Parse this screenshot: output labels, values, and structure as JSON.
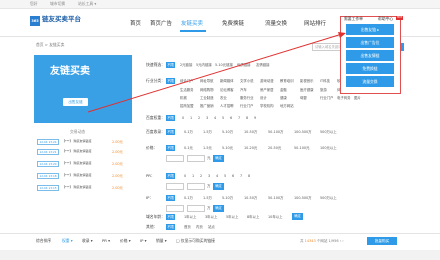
{
  "topbar": {
    "items": [
      "您好",
      "城市切换",
      "站长工具 ▾"
    ]
  },
  "header": {
    "logo_mark": "365",
    "logo_text": "链友买卖平台",
    "nav": [
      "首页",
      "首页广告",
      "友链买卖",
      "免费换链",
      "流量交换",
      "网站排行"
    ],
    "active_nav": "友链买卖"
  },
  "dropdown": {
    "head_left": "需要工作单",
    "head_right": "帮助中心",
    "hot": "HOT",
    "items": [
      "出售友链 ▸",
      "出售广告位",
      "出售友情链",
      "免费换链",
      "流量交换"
    ]
  },
  "breadcrumb": "首页  >  友链买卖",
  "search": {
    "placeholder": "请输入域名关键词",
    "button": "查询"
  },
  "banner": {
    "title": "友链买卖",
    "button": "出售友链"
  },
  "dynamics": {
    "title": "交易动态",
    "rows": [
      {
        "tag": "12-04 13:24",
        "text": "【***】 购买友情链接",
        "price": "2.00元"
      },
      {
        "tag": "12-04 13:21",
        "text": "【***】 购买友情链接",
        "price": "2.00元"
      },
      {
        "tag": "12-04 13:20",
        "text": "【***】 购买友情链接",
        "price": "2.00元"
      },
      {
        "tag": "12-04 13:18",
        "text": "【***】 购买友情链接",
        "price": "2.00元"
      },
      {
        "tag": "12-04 13:15",
        "text": "【***】 购买友情链接",
        "price": "2.00元"
      }
    ]
  },
  "filters": {
    "type": {
      "label": "快速筛选：",
      "options": [
        "不限",
        "2元链接",
        "5元内链接",
        "5-10元链接",
        "优质链接",
        "友情链接"
      ]
    },
    "industry": {
      "label": "行业分类：",
      "rows": [
        [
          "不限",
          "综合门户",
          "网址导航",
          "新闻媒体",
          "文学小说",
          "游戏动漫",
          "教育培训",
          "影视音乐",
          "IT科技",
          "软件下载"
        ],
        [
          "生活服务",
          "网络购物",
          "论坛博客",
          "汽车",
          "房产家居",
          "金融",
          "医疗健康",
          "旅游",
          "体育",
          "其他"
        ],
        [
          "机械",
          "工业制造",
          "农业",
          "服务行业",
          "设计",
          "健康",
          "母婴",
          "行业门户",
          "电子商务",
          "图片"
        ],
        [
          "招商加盟",
          "推广营销",
          "人才招聘",
          "行业门户",
          "学校机构",
          "地方网站"
        ]
      ]
    },
    "weight": {
      "label": "百度权重：",
      "options": [
        "不限",
        "0",
        "1",
        "2",
        "3",
        "4",
        "5",
        "6",
        "7",
        "8",
        "9"
      ]
    },
    "baidu_index": {
      "label": "百度收录：",
      "options": [
        "不限",
        "0-1万",
        "1-5万",
        "5-10万",
        "10-50万",
        "50-100万",
        "100-500万",
        "500万以上"
      ]
    },
    "price": {
      "label": "价格：",
      "options": [
        "不限",
        "0-1元",
        "1-5元",
        "5-10元",
        "10-20元",
        "20-50元",
        "50-100元",
        "100元以上"
      ],
      "unit": "元",
      "button": "确定"
    },
    "pr": {
      "label": "PR：",
      "options": [
        "不限",
        "0",
        "1",
        "2",
        "3",
        "4",
        "5",
        "6",
        "7",
        "8"
      ],
      "unit": "万",
      "button": "确定"
    },
    "ip": {
      "label": "IP：",
      "options": [
        "不限",
        "0-1万",
        "1-5万",
        "5-10万",
        "10-50万",
        "50-100万",
        "100-500万",
        "500万以上"
      ],
      "unit": "万",
      "button": "确定"
    },
    "domain_age": {
      "label": "域名年龄：",
      "options": [
        "不限",
        "1年以上",
        "3年以上",
        "5年以上",
        "8年以上",
        "10年以上"
      ],
      "button": "确定"
    },
    "other": {
      "label": "其他：",
      "options": [
        "不限",
        "首页",
        "内页",
        "站点"
      ]
    }
  },
  "sortbar": {
    "items": [
      "综合排序",
      "权重 ▾",
      "收录 ▾",
      "PR ▾",
      "价格 ▾",
      "IP ▾",
      "销量 ▾",
      "□ 仅显示可购买的链接"
    ],
    "active": "权重 ▾",
    "total_prefix": "共",
    "total_count": "14343",
    "total_suffix": "个网站",
    "pager": "1/956 ‹ ›",
    "buy_button": "批量购买"
  },
  "colors": {
    "accent": "#2f9be8",
    "price": "#f08a30",
    "highlight_border": "#e05050"
  }
}
